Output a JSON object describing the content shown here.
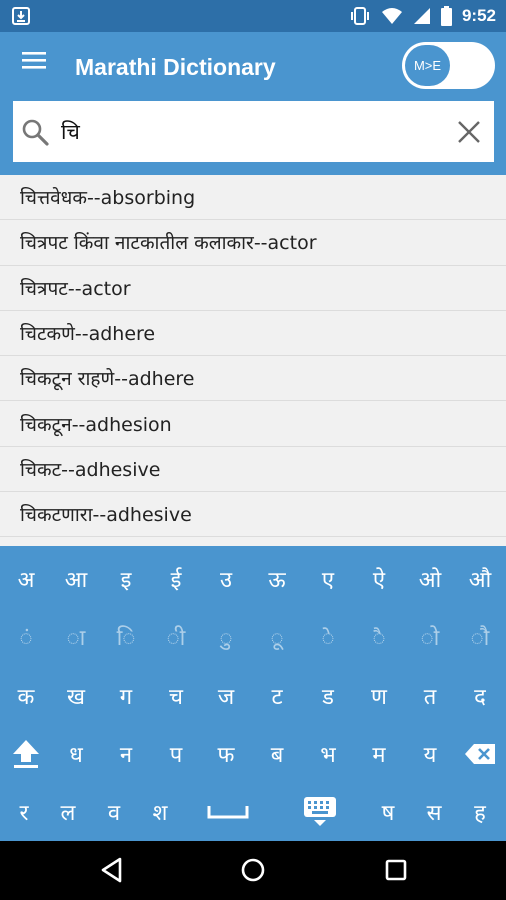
{
  "status_bar": {
    "time": "9:52",
    "left_icon": "download-icon",
    "icons": [
      "vibrate-icon",
      "wifi-icon",
      "signal-icon",
      "battery-icon"
    ]
  },
  "app_bar": {
    "menu_icon": "hamburger-menu-icon",
    "title": "Marathi Dictionary",
    "toggle_label": "M>E"
  },
  "search": {
    "value": "चि",
    "icon": "search-icon",
    "clear_icon": "close-icon"
  },
  "results": [
    "चित्तवेधक--absorbing",
    "चित्रपट किंवा नाटकातील कलाकार--actor",
    "चित्रपट--actor",
    "चिटकणे--adhere",
    "चिकटून राहणे--adhere",
    "चिकटून--adhesion",
    "चिकट--adhesive",
    "चिकटणारा--adhesive"
  ],
  "keyboard": {
    "row1": [
      "अ",
      "आ",
      "इ",
      "ई",
      "उ",
      "ऊ",
      "ए",
      "ऐ",
      "ओ",
      "औ"
    ],
    "row2": [
      "ं",
      "ा",
      "ि",
      "ी",
      "ु",
      "ू",
      "े",
      "ै",
      "ो",
      "ौ"
    ],
    "row3": [
      "क",
      "ख",
      "ग",
      "च",
      "ज",
      "ट",
      "ड",
      "ण",
      "त",
      "द"
    ],
    "row4": [
      "ध",
      "न",
      "प",
      "फ",
      "ब",
      "भ",
      "म",
      "य"
    ],
    "row5_left": [
      "र",
      "ल",
      "व",
      "श"
    ],
    "row5_right": [
      "ष",
      "स",
      "ह"
    ]
  },
  "nav_bar": {
    "icons": [
      "back-icon",
      "home-icon",
      "recents-icon"
    ]
  },
  "colors": {
    "primary": "#4a95cf",
    "status_bar": "#2d6fa8",
    "list_bg": "#f1f1f1"
  }
}
